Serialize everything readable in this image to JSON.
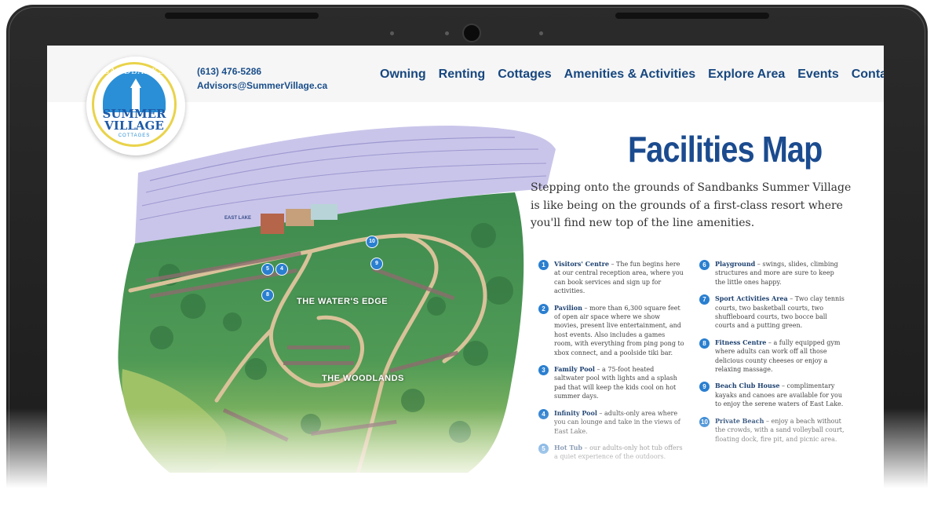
{
  "header": {
    "phone": "(613) 476-5286",
    "email": "Advisors@SummerVillage.ca"
  },
  "logo": {
    "arc_text": "SANDBANKS",
    "line1": "SUMMER",
    "line2": "VILLAGE",
    "line3": "COTTAGES"
  },
  "nav": [
    "Owning",
    "Renting",
    "Cottages",
    "Amenities & Activities",
    "Explore Area",
    "Events",
    "Contact"
  ],
  "page": {
    "title": "Facilities Map",
    "intro": "Stepping onto the grounds of Sandbanks Summer Village is like being on the grounds of a first-class resort where you'll find new top of the line amenities."
  },
  "map": {
    "lake_label": "EAST LAKE",
    "area_1": "THE WATER'S EDGE",
    "area_2": "THE WOODLANDS",
    "pins": [
      "10",
      "9",
      "5",
      "4",
      "8"
    ]
  },
  "facilities_left": [
    {
      "num": "1",
      "name": "Visitors' Centre",
      "desc": " – The fun begins here at our central reception area, where you can book services and sign up for activities."
    },
    {
      "num": "2",
      "name": "Pavilion",
      "desc": " – more than 6,300 square feet of open air space where we show movies, present live entertainment, and host events. Also includes a games room, with everything from ping pong to xbox connect, and a poolside tiki bar."
    },
    {
      "num": "3",
      "name": "Family Pool",
      "desc": " – a 75-foot heated saltwater pool with lights and a splash pad that will keep the kids cool on hot summer days."
    },
    {
      "num": "4",
      "name": "Infinity Pool",
      "desc": " – adults-only area where you can lounge and take in the views of East Lake."
    },
    {
      "num": "5",
      "name": "Hot Tub",
      "desc": " – our adults-only hot tub offers a quiet experience of the outdoors."
    }
  ],
  "facilities_right": [
    {
      "num": "6",
      "name": "Playground",
      "desc": " – swings, slides, climbing structures and more are sure to keep the little ones happy."
    },
    {
      "num": "7",
      "name": "Sport Activities Area",
      "desc": " – Two clay tennis courts, two basketball courts, two shuffleboard courts, two bocce ball courts and a putting green."
    },
    {
      "num": "8",
      "name": "Fitness Centre",
      "desc": " – a fully equipped gym where adults can work off all those delicious county cheeses or enjoy a relaxing massage."
    },
    {
      "num": "9",
      "name": "Beach Club House",
      "desc": " – complimentary kayaks and canoes are available for you to enjoy the serene waters of East Lake."
    },
    {
      "num": "10",
      "name": "Private Beach",
      "desc": " – enjoy a beach without the crowds, with a sand volleyball court, floating dock, fire pit, and picnic area."
    }
  ],
  "colors": {
    "brand_blue": "#1b4b8f",
    "pin_blue": "#2a7fd0",
    "bezel": "#1c1c1c"
  }
}
